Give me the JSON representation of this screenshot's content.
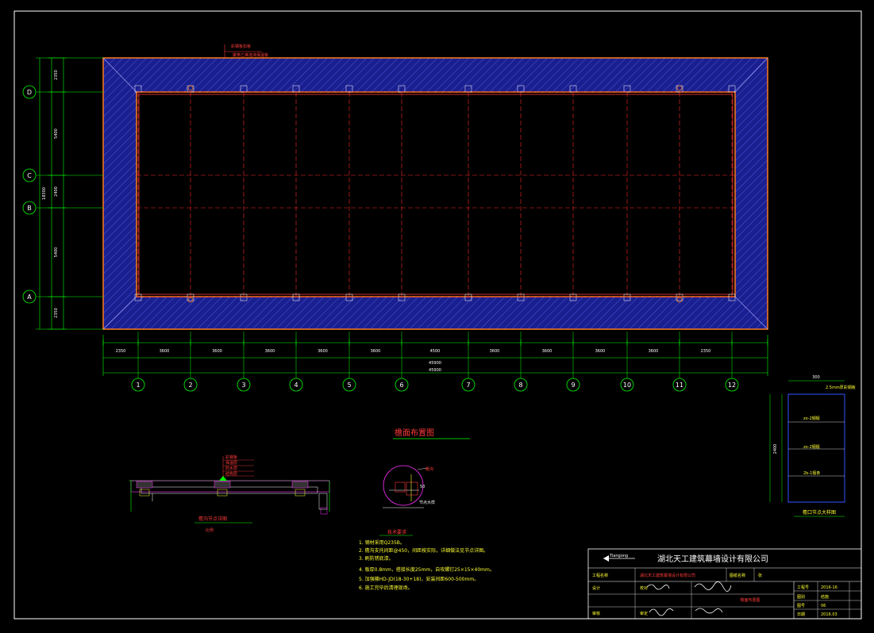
{
  "company": "湖北天工建筑幕墙设计有限公司",
  "logo_text": "Tiangong",
  "main_plan": {
    "grid_cols": [
      "1",
      "2",
      "3",
      "4",
      "5",
      "6",
      "7",
      "8",
      "9",
      "10",
      "11",
      "12"
    ],
    "grid_rows": [
      "D",
      "C",
      "B",
      "A"
    ],
    "top_callout": [
      "彩钢板扣板",
      "聚苯乙烯泡沫保温板"
    ],
    "dim_bottom_segments": [
      "2350",
      "3600",
      "3600",
      "3600",
      "3600",
      "3600",
      "4500",
      "3600",
      "3600",
      "3600",
      "3600",
      "2350"
    ],
    "dim_bottom_totals": [
      "45900",
      "45900"
    ],
    "dim_left_segments": [
      "2350",
      "5400",
      "2400",
      "5400",
      "2350"
    ],
    "dim_left_total": "18300"
  },
  "section": {
    "title": "檐面布置图",
    "detail_caption": "檐沟节点详图",
    "detail_scale": "比例",
    "detail_labels": [
      "彩钢板",
      "保温层",
      "防水层",
      "结构层"
    ],
    "circle_labels": [
      "檐沟",
      "50",
      "节点大样"
    ]
  },
  "tech_requirements": {
    "title": "技术要求",
    "items": [
      "1. 钢材采用Q235B。",
      "2. 檐沟支托间距@450，间距按实际，详细做法见节点详图。",
      "3. 刷防锈底漆。",
      "4. 板厚0.8mm，搭接长度25mm，自攻螺钉25×15×40mm。",
      "5. 加强檩HD-JD(18-30+18)，安装间距600-500mm。",
      "6. 施工完毕后清理现场。"
    ]
  },
  "side_detail": {
    "caption": "檐口节点大样图",
    "top_dim": "300",
    "left_dim": "2400",
    "labels": [
      "2.5mm厚彩钢板",
      "zo-2钢檩",
      "zo-2钢檩",
      "2b-1檩条"
    ]
  },
  "title_block": {
    "project_label": "工程名称",
    "project_value": "湖北天工建筑幕墙设计有限公司",
    "drawing_label": "图纸名称",
    "drawing_name": "檐面布置图",
    "sheet_label": "图号",
    "sheet_value": "张",
    "design": "设计",
    "check": "校对",
    "review": "审核",
    "approve": "审定",
    "right_fields": [
      {
        "label": "工程号",
        "value": "2016-16"
      },
      {
        "label": "图别",
        "value": "结施"
      },
      {
        "label": "图号",
        "value": "06"
      },
      {
        "label": "日期",
        "value": "2016.03"
      }
    ]
  },
  "colors": {
    "frame": "#ffffff",
    "roof_fill": "#1a1f8f",
    "roof_hatch": "#4b55d8",
    "orange": "#ff7a1a",
    "grid_red": "#ff2a2a",
    "dim_green": "#00ff00",
    "yellow": "#ffff33",
    "cyan": "#00ffff",
    "magenta": "#ff33ff"
  }
}
